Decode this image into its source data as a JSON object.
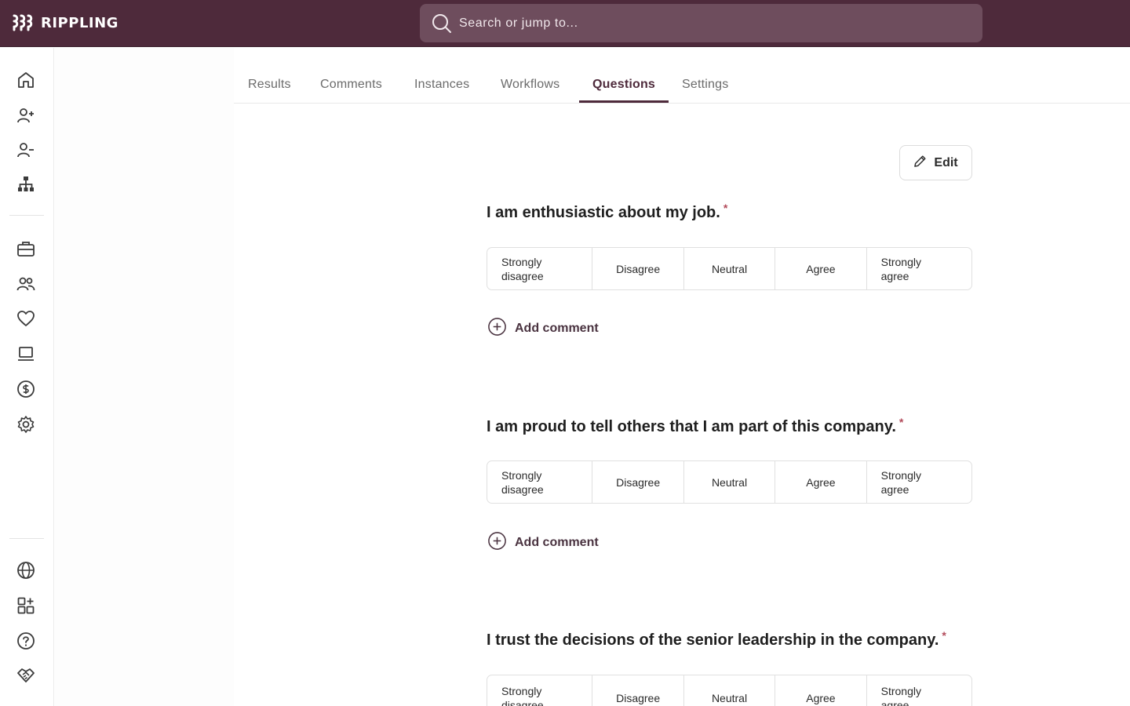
{
  "app": {
    "brand": "RIPPLING"
  },
  "search": {
    "placeholder": "Search or jump to..."
  },
  "tabs": [
    {
      "label": "Results",
      "active": false
    },
    {
      "label": "Comments",
      "active": false
    },
    {
      "label": "Instances",
      "active": false
    },
    {
      "label": "Workflows",
      "active": false
    },
    {
      "label": "Questions",
      "active": true
    },
    {
      "label": "Settings",
      "active": false
    }
  ],
  "toolbar": {
    "edit_label": "Edit"
  },
  "questions": [
    {
      "title": "I am enthusiastic about my job.",
      "required": "*",
      "options": [
        "Strongly disagree",
        "Disagree",
        "Neutral",
        "Agree",
        "Strongly agree"
      ],
      "add_comment": "Add comment"
    },
    {
      "title": "I am proud to tell others that I am part of this company.",
      "required": "*",
      "options": [
        "Strongly disagree",
        "Disagree",
        "Neutral",
        "Agree",
        "Strongly agree"
      ],
      "add_comment": "Add comment"
    },
    {
      "title": "I trust the decisions of the senior leadership in the company.",
      "required": "*",
      "options": [
        "Strongly disagree",
        "Disagree",
        "Neutral",
        "Agree",
        "Strongly agree"
      ]
    }
  ],
  "nav": {
    "icons": [
      "home-icon",
      "add-person-icon",
      "remove-person-icon",
      "org-chart-icon",
      "briefcase-icon",
      "people-icon",
      "heart-icon",
      "laptop-icon",
      "dollar-icon",
      "gear-icon",
      "globe-icon",
      "apps-icon",
      "help-icon",
      "handshake-icon"
    ]
  },
  "colors": {
    "brand": "#4e2a3b",
    "search_bg": "#6e4d5d",
    "required": "#b24a5a"
  }
}
